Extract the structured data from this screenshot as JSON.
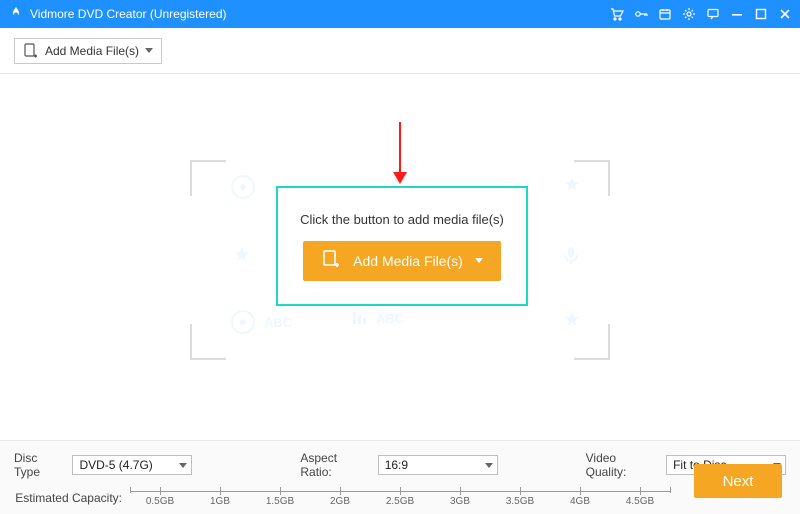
{
  "titlebar": {
    "title": "Vidmore DVD Creator (Unregistered)"
  },
  "toolbar": {
    "add_label": "Add Media File(s)"
  },
  "canvas": {
    "hint": "Click the button to add media file(s)",
    "add_big_label": "Add Media File(s)"
  },
  "footer": {
    "disc_type_label": "Disc Type",
    "disc_type_value": "DVD-5 (4.7G)",
    "aspect_label": "Aspect Ratio:",
    "aspect_value": "16:9",
    "quality_label": "Video Quality:",
    "quality_value": "Fit to Disc",
    "capacity_label": "Estimated Capacity:",
    "ruler_ticks": [
      "0.5GB",
      "1GB",
      "1.5GB",
      "2GB",
      "2.5GB",
      "3GB",
      "3.5GB",
      "4GB",
      "4.5GB"
    ],
    "next_label": "Next"
  },
  "colors": {
    "accent_blue": "#1e90ff",
    "accent_orange": "#f5a623",
    "highlight_teal": "#1fd6c9",
    "arrow_red": "#ff1a1a"
  }
}
